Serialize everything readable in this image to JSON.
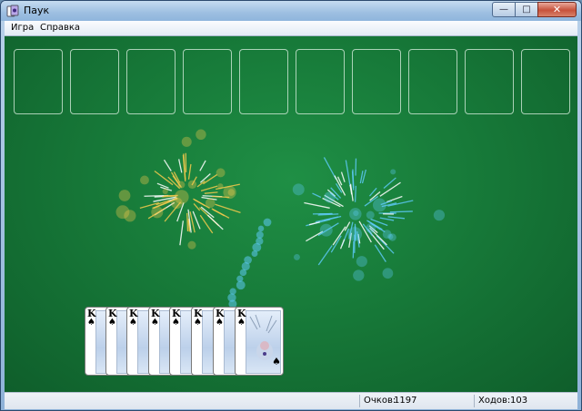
{
  "window": {
    "title": "Паук",
    "icon": "spider-app-icon"
  },
  "caption_buttons": {
    "minimize": "minimize-icon",
    "maximize": "maximize-icon",
    "close": "close-icon"
  },
  "menu": {
    "items": [
      {
        "label": "Игра"
      },
      {
        "label": "Справка"
      }
    ]
  },
  "game": {
    "foundation_slots": 10,
    "completed_run": {
      "ranks": [
        "K",
        "K",
        "K",
        "K",
        "K",
        "K",
        "K",
        "K"
      ],
      "suit": "♠",
      "top_card": {
        "rank": "K",
        "suit": "♠"
      }
    },
    "effect": "fireworks",
    "colors": {
      "felt": "#177a39",
      "firework_gold": "#f2c94c",
      "firework_blue": "#5cc8f2"
    }
  },
  "status": {
    "score_label": "Очков:",
    "score": "1197",
    "moves_label": "Ходов:",
    "moves": "103"
  }
}
